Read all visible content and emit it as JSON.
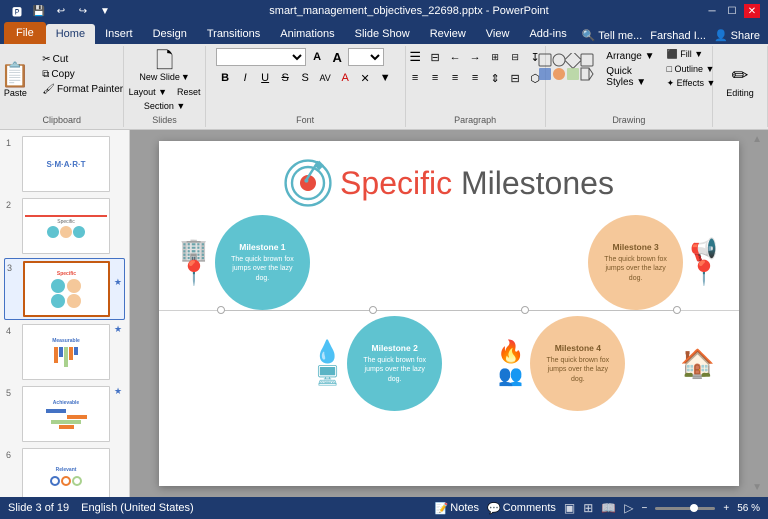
{
  "window": {
    "title": "smart_management_objectives_22698.pptx - PowerPoint",
    "controls": [
      "minimize",
      "maximize",
      "close"
    ]
  },
  "qat": {
    "buttons": [
      "save",
      "undo",
      "redo",
      "customize"
    ]
  },
  "ribbon": {
    "tabs": [
      "File",
      "Home",
      "Insert",
      "Design",
      "Transitions",
      "Animations",
      "Slide Show",
      "Review",
      "View",
      "Add-ins"
    ],
    "active_tab": "Home",
    "tell_me": "Tell me...",
    "user": "Farshad I...",
    "share": "Share",
    "groups": {
      "clipboard": {
        "label": "Clipboard",
        "paste": "Paste",
        "cut": "Cut",
        "copy": "Copy",
        "format_painter": "Format Painter"
      },
      "slides": {
        "label": "Slides",
        "new_slide": "New Slide"
      },
      "font": {
        "label": "Font",
        "font_name": "",
        "font_size": "",
        "bold": "B",
        "italic": "I",
        "underline": "U",
        "strikethrough": "S",
        "shadow": "S",
        "char_spacing": "AV",
        "font_color": "A",
        "increase_size": "A↑",
        "decrease_size": "A↓",
        "clear_format": "✕"
      },
      "paragraph": {
        "label": "Paragraph",
        "bullets": "≡",
        "numbering": "≡#",
        "decrease_indent": "←",
        "increase_indent": "→",
        "align_left": "⬛",
        "center": "⬛",
        "align_right": "⬛",
        "justify": "⬛",
        "columns": "⬛",
        "line_spacing": "⬛",
        "direction": "⬛"
      },
      "drawing": {
        "label": "Drawing",
        "shapes": "Shapes",
        "arrange": "Arrange",
        "quick_styles": "Quick Styles"
      },
      "editing": {
        "label": "Editing",
        "button": "Editing"
      }
    }
  },
  "slides": {
    "current": 3,
    "total": 19,
    "items": [
      {
        "num": "1",
        "label": "Slide 1"
      },
      {
        "num": "2",
        "label": "Slide 2"
      },
      {
        "num": "3",
        "label": "Slide 3",
        "active": true
      },
      {
        "num": "4",
        "label": "Slide 4"
      },
      {
        "num": "5",
        "label": "Slide 5"
      },
      {
        "num": "6",
        "label": "Slide 6"
      }
    ]
  },
  "slide_content": {
    "title_specific": "Specific",
    "title_rest": " Milestones",
    "milestones": [
      {
        "id": 1,
        "title": "Milestone 1",
        "text": "The quick brown fox jumps over the lazy dog.",
        "position": "top-left",
        "bubble_color": "blue"
      },
      {
        "id": 2,
        "title": "Milestone 2",
        "text": "The quick brown fox jumps over the lazy dog.",
        "position": "bottom-center",
        "bubble_color": "blue"
      },
      {
        "id": 3,
        "title": "Milestone 3",
        "text": "The quick brown fox jumps over the lazy dog.",
        "position": "top-right",
        "bubble_color": "peach"
      },
      {
        "id": 4,
        "title": "Milestone 4",
        "text": "The quick brown fox jumps over the lazy dog.",
        "position": "bottom-right",
        "bubble_color": "peach"
      }
    ]
  },
  "status_bar": {
    "slide_info": "Slide 3 of 19",
    "language": "English (United States)",
    "notes": "Notes",
    "comments": "Comments",
    "zoom": "56 %"
  }
}
